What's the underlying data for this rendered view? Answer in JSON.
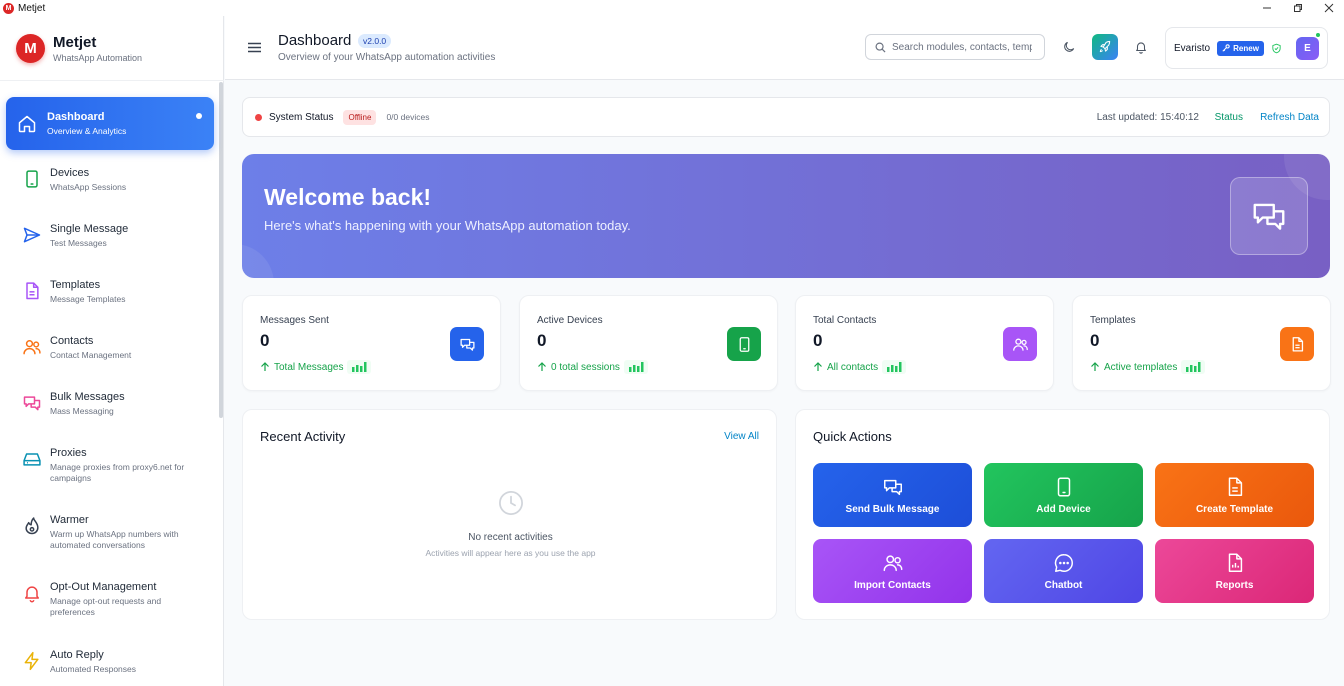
{
  "window": {
    "title": "Metjet",
    "logo_letter": "M"
  },
  "brand": {
    "logo_letter": "M",
    "name": "Metjet",
    "subtitle": "WhatsApp Automation"
  },
  "sidebar": {
    "items": [
      {
        "label": "Dashboard",
        "sub": "Overview & Analytics",
        "icon": "home-icon",
        "color": "#ffffff",
        "active": true
      },
      {
        "label": "Devices",
        "sub": "WhatsApp Sessions",
        "icon": "smartphone-icon",
        "color": "#16a34a"
      },
      {
        "label": "Single Message",
        "sub": "Test Messages",
        "icon": "send-icon",
        "color": "#2563eb"
      },
      {
        "label": "Templates",
        "sub": "Message Templates",
        "icon": "file-icon",
        "color": "#a855f7"
      },
      {
        "label": "Contacts",
        "sub": "Contact Management",
        "icon": "users-icon",
        "color": "#f97316"
      },
      {
        "label": "Bulk Messages",
        "sub": "Mass Messaging",
        "icon": "messages-icon",
        "color": "#ec4899"
      },
      {
        "label": "Proxies",
        "sub": "Manage proxies from proxy6.net for campaigns",
        "icon": "server-icon",
        "color": "#0891b2"
      },
      {
        "label": "Warmer",
        "sub": "Warm up WhatsApp numbers with automated conversations",
        "icon": "flame-icon",
        "color": "#374151"
      },
      {
        "label": "Opt-Out Management",
        "sub": "Manage opt-out requests and preferences",
        "icon": "bell-icon",
        "color": "#ef4444"
      },
      {
        "label": "Auto Reply",
        "sub": "Automated Responses",
        "icon": "zap-icon",
        "color": "#eab308"
      }
    ]
  },
  "header": {
    "title": "Dashboard",
    "version": "v2.0.0",
    "subtitle": "Overview of your WhatsApp automation activities",
    "search_placeholder": "Search modules, contacts, templates...",
    "user_name": "Evaristo",
    "renew_label": "Renew",
    "avatar_letter": "E"
  },
  "status": {
    "label": "System Status",
    "state": "Offline",
    "devices": "0/0 devices",
    "last_updated": "Last updated: 15:40:12",
    "status_link": "Status",
    "refresh_link": "Refresh Data"
  },
  "hero": {
    "title": "Welcome back!",
    "subtitle": "Here's what's happening with your WhatsApp automation today."
  },
  "stats": [
    {
      "label": "Messages Sent",
      "value": "0",
      "trend": "Total Messages",
      "color": "#2563eb",
      "icon": "message-icon"
    },
    {
      "label": "Active Devices",
      "value": "0",
      "trend": "0 total sessions",
      "color": "#16a34a",
      "icon": "smartphone-icon"
    },
    {
      "label": "Total Contacts",
      "value": "0",
      "trend": "All contacts",
      "color": "#a855f7",
      "icon": "users-icon"
    },
    {
      "label": "Templates",
      "value": "0",
      "trend": "Active templates",
      "color": "#f97316",
      "icon": "file-icon"
    }
  ],
  "recent": {
    "title": "Recent Activity",
    "view_all": "View All",
    "empty_title": "No recent activities",
    "empty_sub": "Activities will appear here as you use the app"
  },
  "quick": {
    "title": "Quick Actions",
    "actions": [
      {
        "label": "Send Bulk Message",
        "icon": "messages-icon",
        "color": "#1d4ed8"
      },
      {
        "label": "Add Device",
        "icon": "smartphone-icon",
        "color": "#16a34a"
      },
      {
        "label": "Create Template",
        "icon": "file-icon",
        "color": "#ea580c"
      },
      {
        "label": "Import Contacts",
        "icon": "users-icon",
        "color": "#a21caf"
      },
      {
        "label": "Chatbot",
        "icon": "chat-icon",
        "color": "#4f46e5"
      },
      {
        "label": "Reports",
        "icon": "report-icon",
        "color": "#db2777"
      }
    ]
  }
}
